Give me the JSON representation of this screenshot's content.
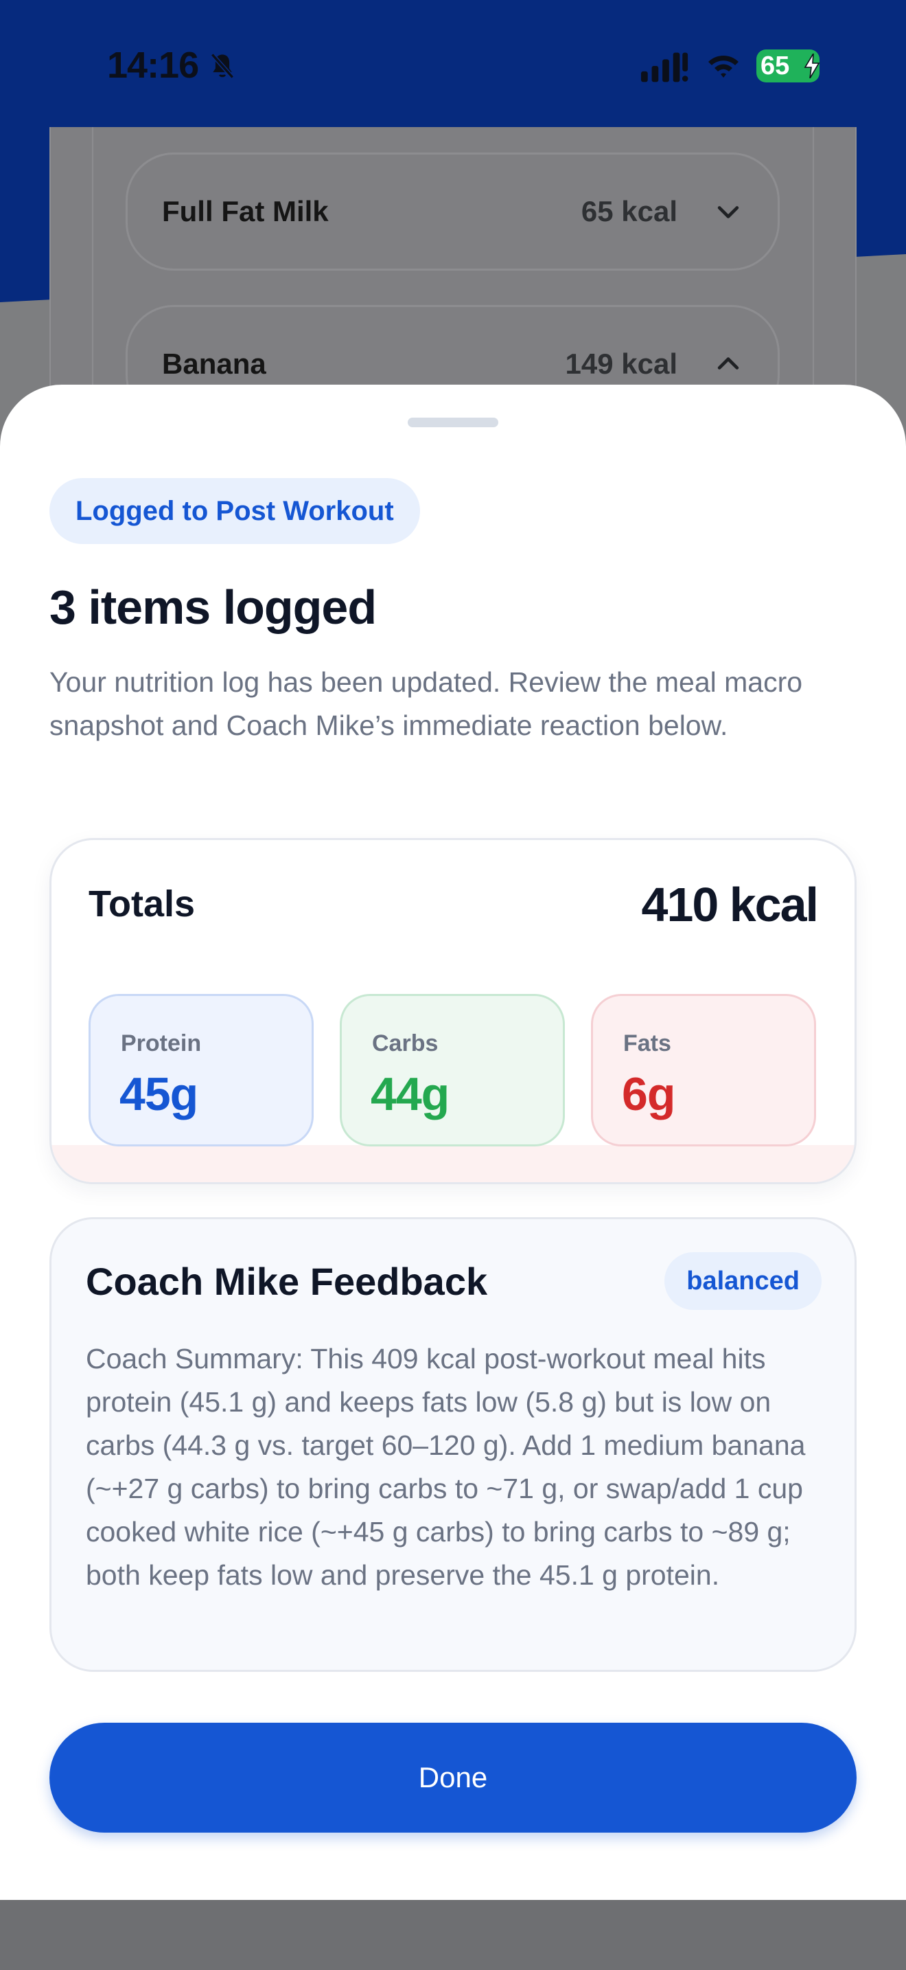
{
  "status_bar": {
    "time": "14:16",
    "battery": "65",
    "icons": [
      "bell-slash-icon",
      "signal-icon",
      "wifi-icon",
      "charging-bolt-icon"
    ],
    "battery_color": "#1fb25a"
  },
  "background": {
    "items": [
      {
        "name": "Full Fat Milk",
        "kcal": "65 kcal",
        "chevron": "chevron-down-icon"
      },
      {
        "name": "Banana",
        "kcal": "149 kcal",
        "chevron": "chevron-up-icon"
      }
    ]
  },
  "sheet": {
    "badge": "Logged to Post Workout",
    "title": "3 items logged",
    "description": "Your nutrition log has been updated. Review the meal macro snapshot and Coach Mike’s immediate reaction below.",
    "totals": {
      "label": "Totals",
      "value": "410 kcal",
      "macros": [
        {
          "label": "Protein",
          "value": "45g",
          "color": "#1556d3"
        },
        {
          "label": "Carbs",
          "value": "44g",
          "color": "#24a84f"
        },
        {
          "label": "Fats",
          "value": "6g",
          "color": "#d42a2a"
        }
      ]
    },
    "feedback": {
      "title": "Coach Mike Feedback",
      "badge": "balanced",
      "text": "Coach Summary: This 409 kcal post-workout meal hits protein (45.1 g) and keeps fats low (5.8 g) but is low on carbs (44.3 g vs. target 60–120 g). Add 1 medium banana (~+27 g carbs) to bring carbs to ~71 g, or swap/add 1 cup cooked white rice (~+45 g carbs) to bring carbs to ~89 g; both keep fats low and preserve the 45.1 g protein."
    },
    "done_label": "Done"
  },
  "colors": {
    "accent": "#1556d3",
    "header_blue": "#062a7e"
  }
}
